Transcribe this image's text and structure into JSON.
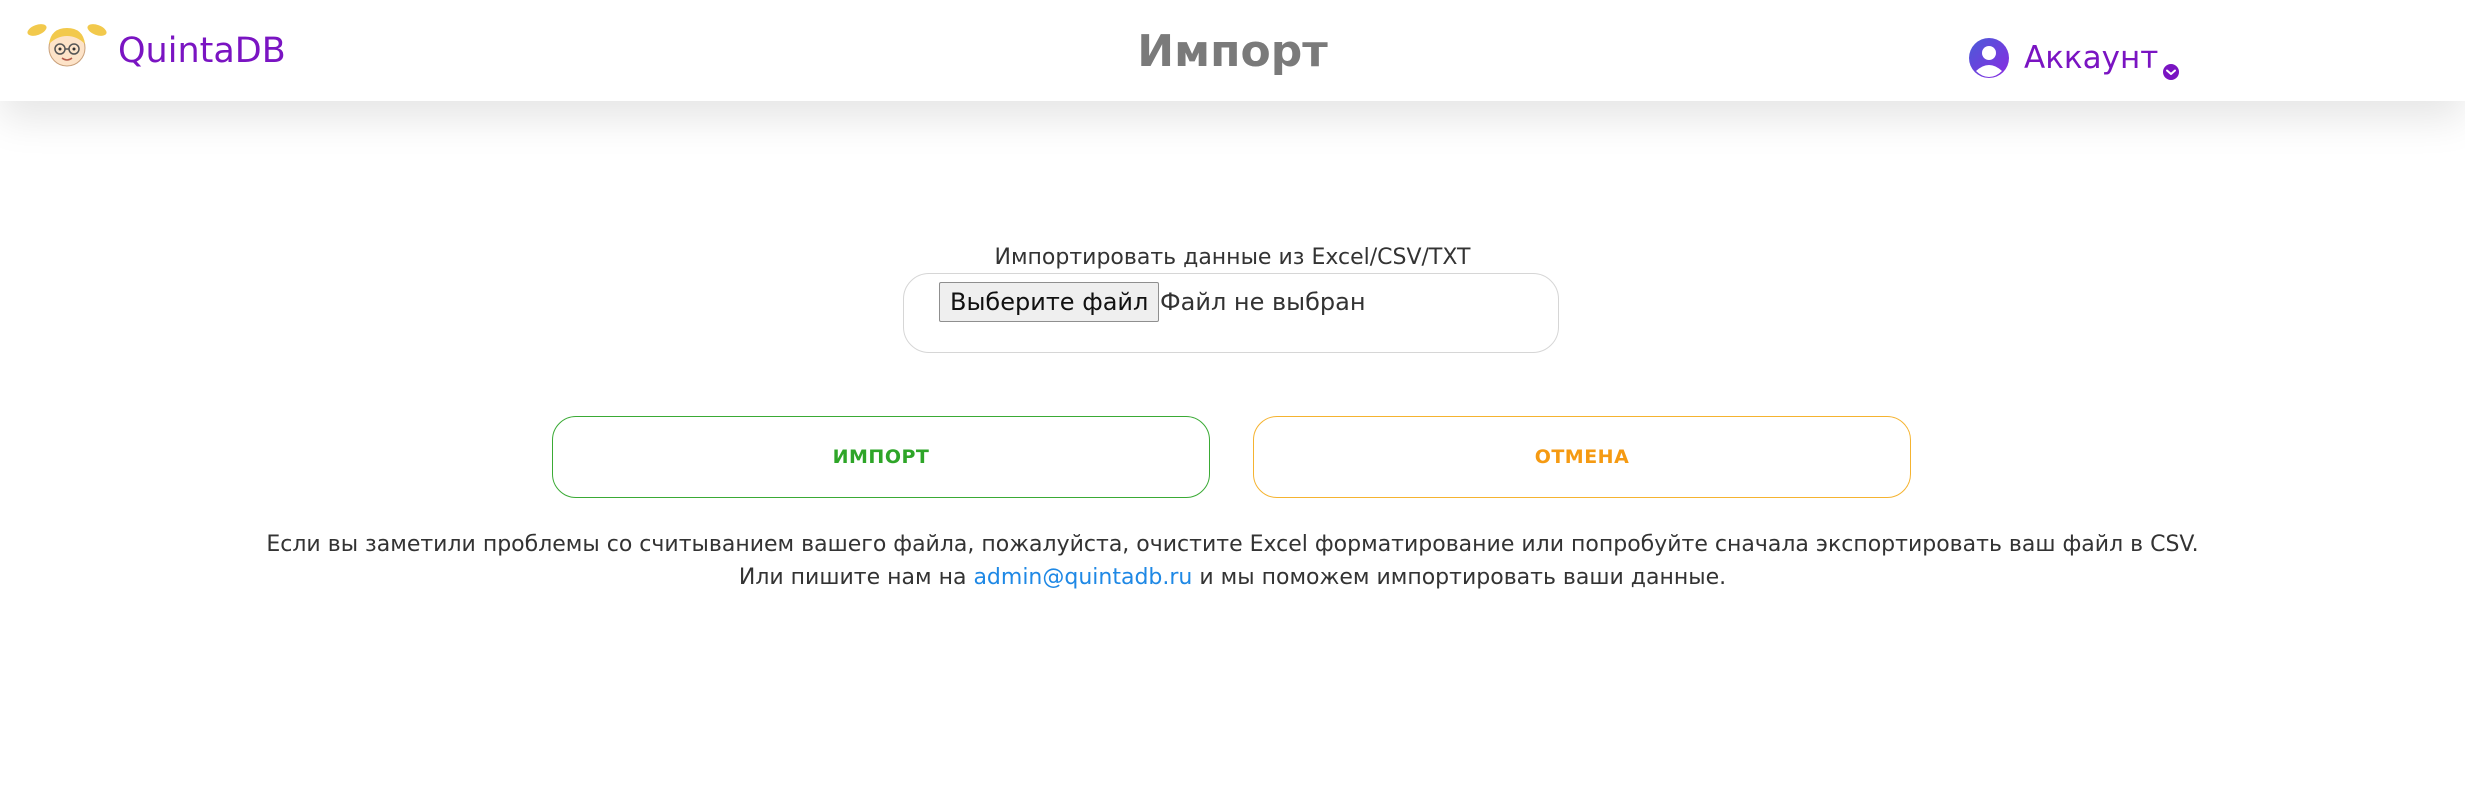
{
  "header": {
    "brand": "QuintaDB",
    "title": "Импорт",
    "account_label": "Аккаунт",
    "accent_color": "#7a14c2"
  },
  "import_form": {
    "label": "Импортировать данные из Excel/CSV/TXT",
    "choose_file_button": "Выберите файл",
    "file_status": "Файл не выбран"
  },
  "actions": {
    "import_label": "ИМПОРТ",
    "cancel_label": "ОТМЕНА",
    "import_color": "#2ea528",
    "cancel_color": "#f59a12"
  },
  "help": {
    "line1": "Если вы заметили проблемы со считыванием вашего файла, пожалуйста, очистите Excel форматирование или попробуйте сначала экспортировать ваш файл в CSV.",
    "line2_prefix": "Или пишите нам на ",
    "email": "admin@quintadb.ru",
    "line2_suffix": " и мы поможем импортировать ваши данные."
  }
}
